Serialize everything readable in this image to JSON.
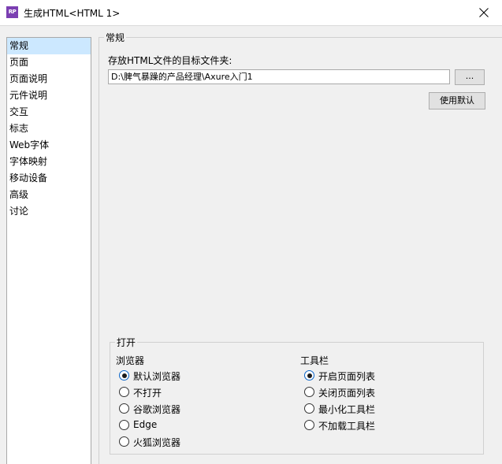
{
  "window": {
    "icon_text": "RP",
    "title": "生成HTML<HTML 1>"
  },
  "sidebar": {
    "items": [
      {
        "label": "常规",
        "selected": true
      },
      {
        "label": "页面"
      },
      {
        "label": "页面说明"
      },
      {
        "label": "元件说明"
      },
      {
        "label": "交互"
      },
      {
        "label": "标志"
      },
      {
        "label": "Web字体"
      },
      {
        "label": "字体映射"
      },
      {
        "label": "移动设备"
      },
      {
        "label": "高级"
      },
      {
        "label": "讨论"
      }
    ]
  },
  "general": {
    "legend": "常规",
    "folder_label": "存放HTML文件的目标文件夹:",
    "folder_value": "D:\\脾气暴躁的产品经理\\Axure入门1",
    "browse_label": "...",
    "use_default_label": "使用默认"
  },
  "open": {
    "legend": "打开",
    "browser": {
      "heading": "浏览器",
      "options": [
        "默认浏览器",
        "不打开",
        "谷歌浏览器",
        "Edge",
        "火狐浏览器"
      ],
      "selected": "默认浏览器"
    },
    "toolbar": {
      "heading": "工具栏",
      "options": [
        "开启页面列表",
        "关闭页面列表",
        "最小化工具栏",
        "不加载工具栏"
      ],
      "selected": "开启页面列表"
    }
  },
  "colors": {
    "selection": "#cce8ff",
    "app_icon": "#7b3fb2"
  }
}
